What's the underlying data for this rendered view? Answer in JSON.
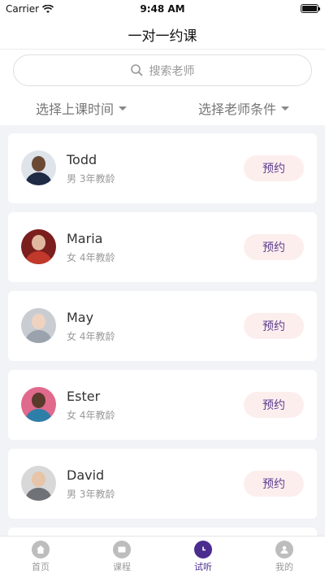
{
  "status_bar": {
    "carrier": "Carrier",
    "time": "9:48 AM"
  },
  "header": {
    "title": "一对一约课"
  },
  "search": {
    "placeholder": "搜索老师"
  },
  "filters": {
    "time": "选择上课时间",
    "teacher": "选择老师条件"
  },
  "teachers": [
    {
      "name": "Todd",
      "meta": "男 3年教龄",
      "button": "预约"
    },
    {
      "name": "Maria",
      "meta": "女 4年教龄",
      "button": "预约"
    },
    {
      "name": "May",
      "meta": "女 4年教龄",
      "button": "预约"
    },
    {
      "name": "Ester",
      "meta": "女 4年教龄",
      "button": "预约"
    },
    {
      "name": "David",
      "meta": "男 3年教龄",
      "button": "预约"
    }
  ],
  "tabs": [
    {
      "label": "首页",
      "icon": "home-icon"
    },
    {
      "label": "课程",
      "icon": "course-icon"
    },
    {
      "label": "试听",
      "icon": "clock-icon"
    },
    {
      "label": "我的",
      "icon": "user-icon"
    }
  ],
  "colors": {
    "accent": "#4b2c8f",
    "button_bg": "#fdeeee",
    "page_bg": "#f2f3f7"
  }
}
